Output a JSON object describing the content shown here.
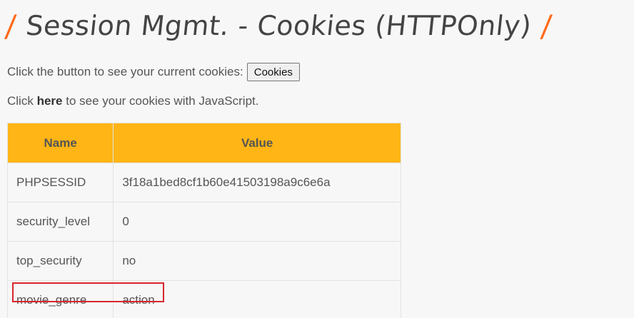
{
  "header": {
    "slash_left": "/",
    "title": "Session Mgmt. - Cookies (HTTPOnly)",
    "slash_right": "/"
  },
  "intro": {
    "button_prompt": "Click the button to see your current cookies:",
    "button_label": "Cookies",
    "link_prefix": "Click",
    "link_text": "here",
    "link_suffix": "to see your cookies with JavaScript."
  },
  "table": {
    "headers": [
      "Name",
      "Value"
    ],
    "rows": [
      {
        "name": "PHPSESSID",
        "value": "3f18a1bed8cf1b60e41503198a9c6e6a"
      },
      {
        "name": "security_level",
        "value": "0"
      },
      {
        "name": "top_security",
        "value": "no"
      },
      {
        "name": "movie_genre",
        "value": "action"
      }
    ]
  },
  "colors": {
    "header_bg": "#ffb515",
    "accent_slash": "#ff6a1a",
    "highlight_border": "#d9262e"
  }
}
